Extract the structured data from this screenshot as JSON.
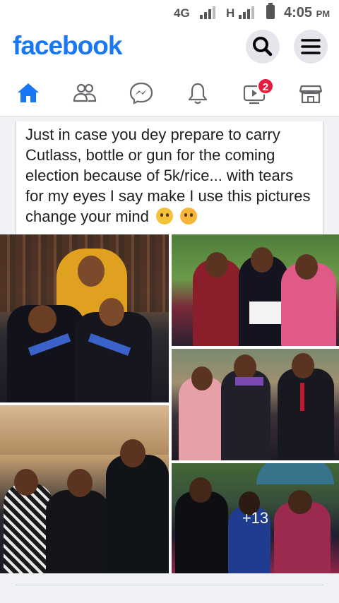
{
  "status_bar": {
    "network_1": "4G",
    "network_2": "H",
    "time": "4:05",
    "ampm": "PM"
  },
  "header": {
    "logo": "facebook",
    "search_icon": "search-icon",
    "menu_icon": "menu-icon"
  },
  "nav": {
    "items": [
      {
        "icon": "home-icon",
        "active": true
      },
      {
        "icon": "friends-icon"
      },
      {
        "icon": "messenger-icon"
      },
      {
        "icon": "bell-icon"
      },
      {
        "icon": "watch-icon",
        "badge": "2"
      },
      {
        "icon": "marketplace-icon"
      }
    ]
  },
  "post": {
    "text": "Just in case you dey prepare to carry Cutlass, bottle or gun for the coming election because of 5k/rice... with tears for my eyes I say make I use this pictures change your mind",
    "more_photos": "+13"
  },
  "colors": {
    "brand": "#1877f2",
    "badge": "#e41e3f",
    "icon_grey": "#65676b"
  }
}
